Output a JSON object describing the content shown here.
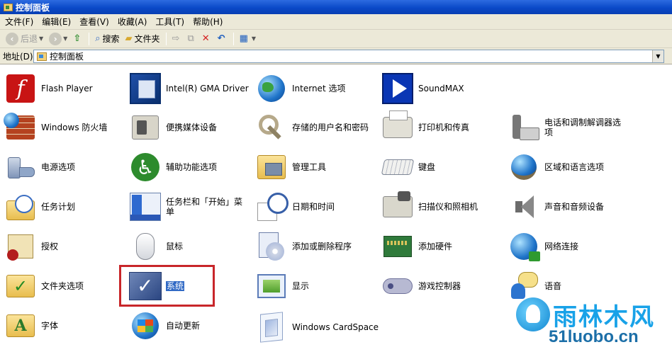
{
  "window": {
    "title": "控制面板"
  },
  "menu": {
    "items": [
      "文件(F)",
      "编辑(E)",
      "查看(V)",
      "收藏(A)",
      "工具(T)",
      "帮助(H)"
    ]
  },
  "toolbar": {
    "back_label": "后退",
    "search_label": "搜索",
    "folders_label": "文件夹"
  },
  "address": {
    "label": "地址(D)",
    "value": "控制面板"
  },
  "items": [
    {
      "label": "Flash Player",
      "icon": "flash-player-icon"
    },
    {
      "label": "Intel(R) GMA Driver",
      "icon": "intel-gma-icon"
    },
    {
      "label": "Internet 选项",
      "icon": "internet-options-icon"
    },
    {
      "label": "SoundMAX",
      "icon": "soundmax-icon"
    },
    {
      "label": "Windows 防火墙",
      "icon": "firewall-icon"
    },
    {
      "label": "便携媒体设备",
      "icon": "portable-media-icon"
    },
    {
      "label": "存储的用户名和密码",
      "icon": "keys-icon"
    },
    {
      "label": "打印机和传真",
      "icon": "printer-icon"
    },
    {
      "label": "电话和调制解调器选项",
      "icon": "phone-modem-icon"
    },
    {
      "label": "电源选项",
      "icon": "power-icon"
    },
    {
      "label": "辅助功能选项",
      "icon": "accessibility-icon"
    },
    {
      "label": "管理工具",
      "icon": "admin-tools-icon"
    },
    {
      "label": "键盘",
      "icon": "keyboard-icon"
    },
    {
      "label": "区域和语言选项",
      "icon": "region-language-icon"
    },
    {
      "label": "任务计划",
      "icon": "scheduled-tasks-icon"
    },
    {
      "label": "任务栏和「开始」菜单",
      "icon": "taskbar-start-icon"
    },
    {
      "label": "日期和时间",
      "icon": "date-time-icon"
    },
    {
      "label": "扫描仪和照相机",
      "icon": "scanner-camera-icon"
    },
    {
      "label": "声音和音频设备",
      "icon": "sound-icon"
    },
    {
      "label": "授权",
      "icon": "license-icon"
    },
    {
      "label": "鼠标",
      "icon": "mouse-icon"
    },
    {
      "label": "添加或删除程序",
      "icon": "add-remove-icon"
    },
    {
      "label": "添加硬件",
      "icon": "add-hardware-icon"
    },
    {
      "label": "网络连接",
      "icon": "network-icon"
    },
    {
      "label": "文件夹选项",
      "icon": "folder-options-icon"
    },
    {
      "label": "系统",
      "icon": "system-icon"
    },
    {
      "label": "显示",
      "icon": "display-icon"
    },
    {
      "label": "游戏控制器",
      "icon": "game-controller-icon"
    },
    {
      "label": "语音",
      "icon": "speech-icon"
    },
    {
      "label": "字体",
      "icon": "fonts-icon"
    },
    {
      "label": "自动更新",
      "icon": "auto-update-icon"
    },
    {
      "label": "Windows CardSpace",
      "icon": "cardspace-icon"
    }
  ],
  "watermark": {
    "cn": "雨林木风",
    "en": "51luobo.cn"
  },
  "colors": {
    "titlebar": "#0a49c8",
    "chrome": "#ece9d8",
    "highlight_box": "#c8262a",
    "selection": "#316ac5"
  }
}
